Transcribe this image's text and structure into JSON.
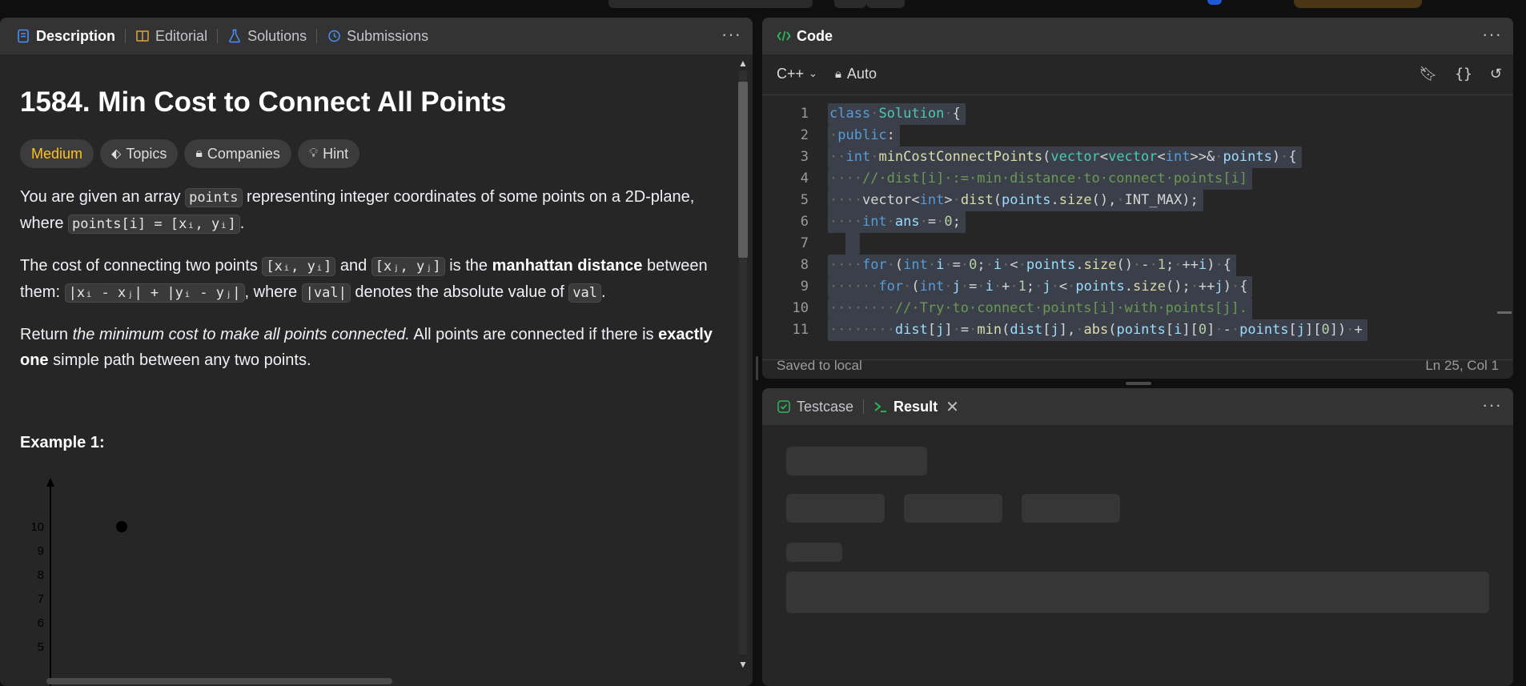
{
  "left_panel": {
    "tabs": [
      {
        "label": "Description",
        "icon": "description-icon"
      },
      {
        "label": "Editorial",
        "icon": "book-icon"
      },
      {
        "label": "Solutions",
        "icon": "flask-icon"
      },
      {
        "label": "Submissions",
        "icon": "history-icon"
      }
    ],
    "title": "1584. Min Cost to Connect All Points",
    "chips": {
      "difficulty": "Medium",
      "topics": "Topics",
      "companies": "Companies",
      "hint": "Hint"
    },
    "para1": {
      "t1": "You are given an array ",
      "c1": "points",
      "t2": " representing integer coordinates of some points on a 2D-plane, where ",
      "c2": "points[i] = [xᵢ, yᵢ]",
      "t3": "."
    },
    "para2": {
      "t1": "The cost of connecting two points ",
      "c1": "[xᵢ, yᵢ]",
      "t2": " and ",
      "c2": "[xⱼ, yⱼ]",
      "t3": " is the ",
      "b1": "manhattan distance",
      "t4": " between them: ",
      "c3": "|xᵢ - xⱼ| + |yᵢ - yⱼ|",
      "t5": ", where ",
      "c4": "|val|",
      "t6": " denotes the absolute value of ",
      "c5": "val",
      "t7": "."
    },
    "para3": {
      "t1": "Return ",
      "i1": "the minimum cost to make all points connected.",
      "t2": " All points are connected if there is ",
      "b1": "exactly one",
      "t3": " simple path between any two points."
    },
    "example_heading": "Example 1:",
    "plot_ticks": [
      "10",
      "9",
      "8",
      "7",
      "6",
      "5"
    ]
  },
  "code_panel": {
    "title": "Code",
    "language": "C++",
    "mode": "Auto",
    "status_left": "Saved to local",
    "status_right": "Ln 25, Col 1"
  },
  "result_panel": {
    "tabs": [
      {
        "label": "Testcase"
      },
      {
        "label": "Result"
      }
    ]
  },
  "colors": {
    "difficulty_medium": "#ffc01e",
    "code_icon": "#2cbb5d",
    "background": "#262626"
  }
}
